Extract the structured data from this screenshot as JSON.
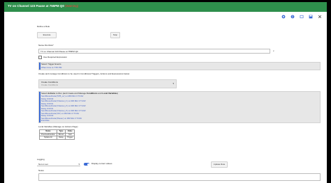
{
  "window": {
    "title": "TV on Channel 123 Pause at 755PM Q0",
    "title_warning": "(Warning)"
  },
  "toolbar_icons": [
    "gear-icon",
    "help-icon",
    "table-icon",
    "save-icon",
    "close-icon"
  ],
  "define_rule_label": "Define a Rule",
  "buttons": {
    "execute": "Execute",
    "stop": "Stop",
    "update_rule": "Update Rule"
  },
  "name_label": "Name this Rule*",
  "name_value": "TV on Channel 123 Pause at 755PM Q0",
  "required_mark": "x",
  "logical_expressions_label": "Use Required Expression",
  "trigger": {
    "title": "Select Trigger Events",
    "value": "When time is 7:55 PM"
  },
  "conditions_intro": "Create and manage Conditions to be used in Conditional Triggers, Actions and Expressions below:",
  "conditions": {
    "title": "Create Conditions",
    "placeholder": "Create Conditions"
  },
  "actions": {
    "title_prefix": "Select ",
    "title_bold1": "Actions",
    "title_mid": " to Run (and Create and Manage ",
    "title_bold2": "Conditions",
    "title_and": " and ",
    "title_bold3": "Local Variables",
    "title_suffix": ")",
    "lines": [
      "SendStoredCode('STB_on') on RM Mini 3 TV/AV",
      "Delay 0:00:03",
      "SendStoredCode('Channel_1') on RM Mini 3 TV/AV",
      "Delay 0:00:01",
      "SendStoredCode('Channel_2') on RM Mini 3 TV/AV",
      "Delay 0:00:01",
      "SendStoredCode('Channel_3') on RM Mini 3 TV/AV",
      "SendStoredCode('OK') on RM Mini 3 TV/AV",
      "Delay 0:00:03",
      "SendStoredCode('Pause') on RM Mini 3 TV/AV",
      "End-Rule"
    ]
  },
  "local_variables": {
    "label": "Local Variables (Manage on Actions Page)",
    "headers": [
      "Name",
      "Type",
      "Value"
    ],
    "rows": [
      [
        "PreviousDuration",
        "BCmd",
        "Null"
      ],
      [
        "SpikeLimit",
        "Delay",
        "Trigger"
      ]
    ]
  },
  "logging": {
    "label": "Logging",
    "select_value": "Not on set"
  },
  "display_current_values_label": "Display current values",
  "notes_label": "Notes"
}
